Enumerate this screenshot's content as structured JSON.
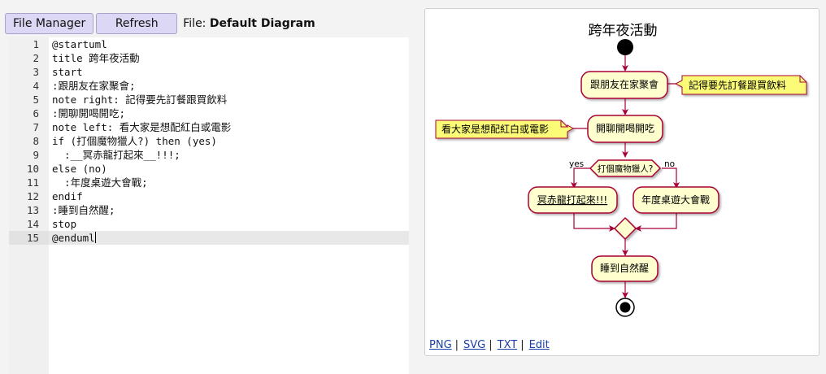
{
  "toolbar": {
    "file_manager_label": "File Manager",
    "refresh_label": "Refresh",
    "file_prefix": "File: ",
    "file_name": "Default Diagram"
  },
  "editor": {
    "lines": [
      {
        "num": "1",
        "text": "@startuml"
      },
      {
        "num": "2",
        "text": "title 跨年夜活動"
      },
      {
        "num": "3",
        "text": "start"
      },
      {
        "num": "4",
        "text": ":跟朋友在家聚會;"
      },
      {
        "num": "5",
        "text": "note right: 記得要先訂餐跟買飲料"
      },
      {
        "num": "6",
        "text": ":開聊開喝開吃;"
      },
      {
        "num": "7",
        "text": "note left: 看大家是想配紅白或電影"
      },
      {
        "num": "8",
        "text": "if (打個魔物獵人?) then (yes)"
      },
      {
        "num": "9",
        "text": "  :__冥赤龍打起來__!!!;"
      },
      {
        "num": "10",
        "text": "else (no)"
      },
      {
        "num": "11",
        "text": "  :年度桌遊大會戰;"
      },
      {
        "num": "12",
        "text": "endif"
      },
      {
        "num": "13",
        "text": ":睡到自然醒;"
      },
      {
        "num": "14",
        "text": "stop"
      },
      {
        "num": "15",
        "text": "@enduml"
      }
    ],
    "active_line": 15
  },
  "diagram": {
    "title": "跨年夜活動",
    "activity_gather": "跟朋友在家聚會",
    "note_right": "記得要先訂餐跟買飲料",
    "activity_chat": "開聊開喝開吃",
    "note_left": "看大家是想配紅白或電影",
    "decision": "打個魔物獵人?",
    "yes_label": "yes",
    "no_label": "no",
    "activity_yes": "冥赤龍打起來!!!",
    "activity_no": "年度桌遊大會戰",
    "activity_sleep": "睡到自然醒",
    "colors": {
      "activity_fill": "#fefece",
      "border": "#a80036",
      "note_fill": "#fbfb77",
      "note_border": "#a80036",
      "node": "#000000"
    }
  },
  "links": {
    "png": "PNG",
    "svg": "SVG",
    "txt": "TXT",
    "edit": "Edit",
    "separator": "|"
  }
}
